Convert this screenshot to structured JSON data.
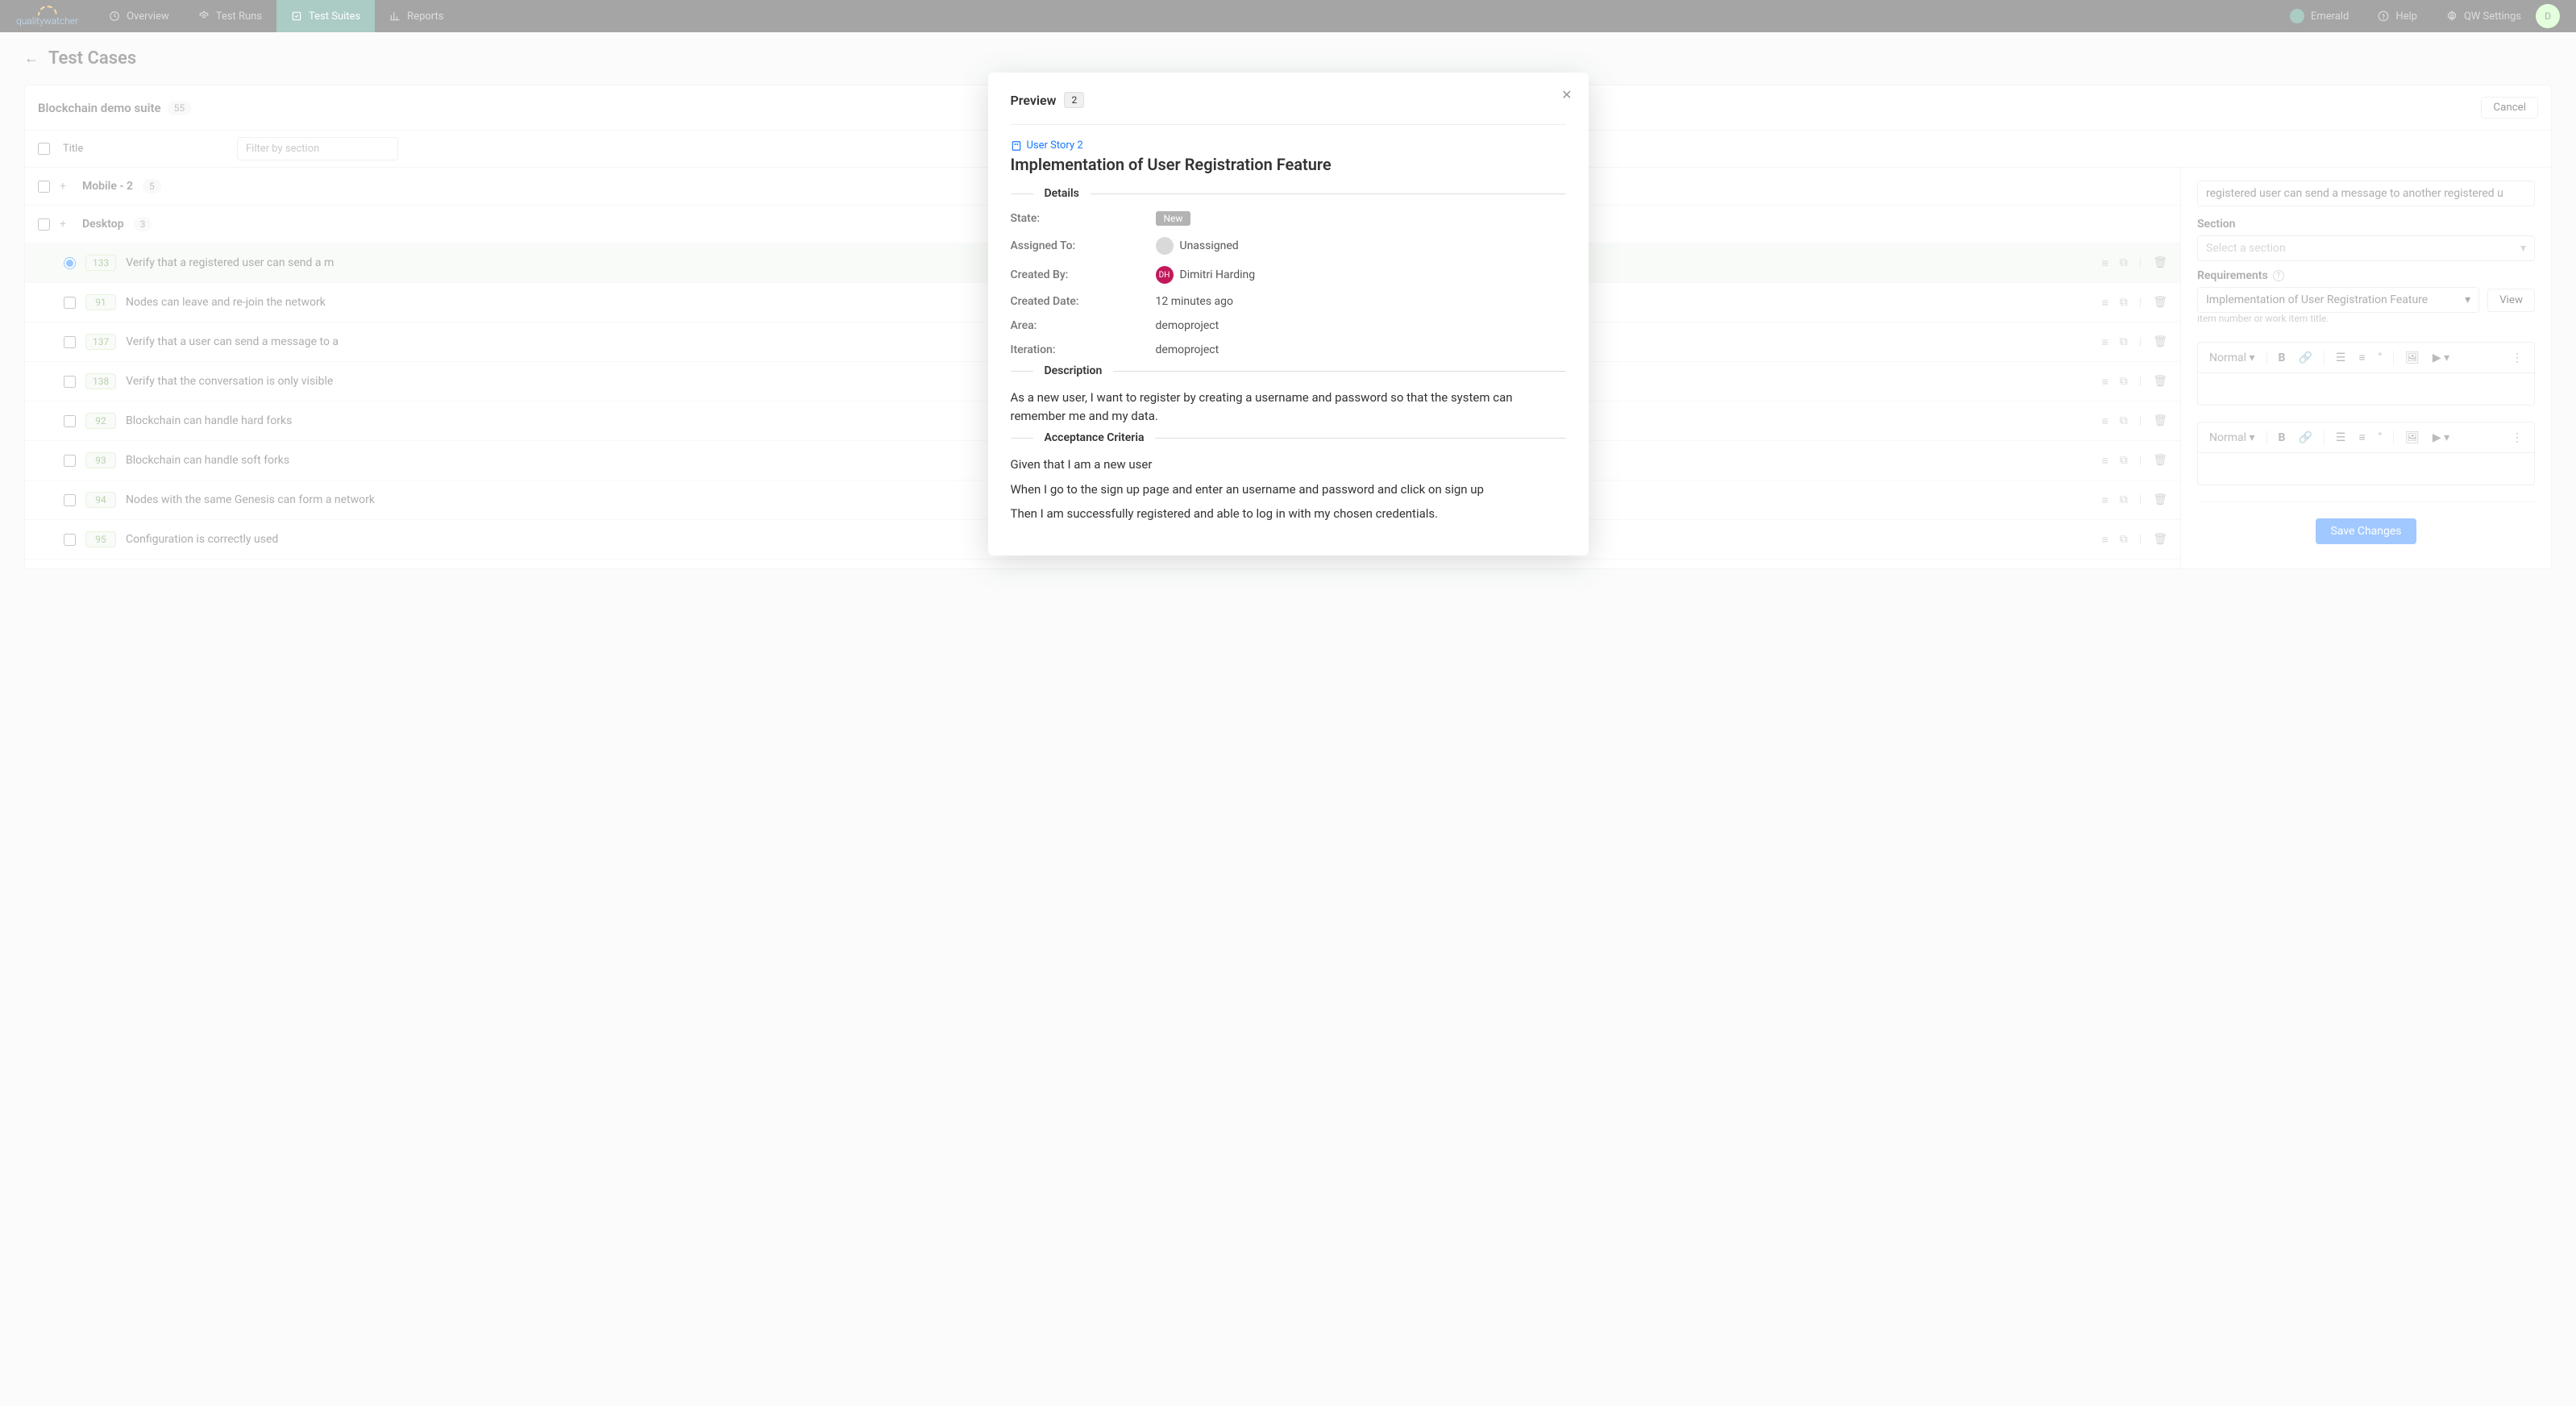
{
  "nav": {
    "logo": "qualitywatcher",
    "items": [
      "Overview",
      "Test Runs",
      "Test Suites",
      "Reports"
    ],
    "active_index": 2,
    "project": "Emerald",
    "help": "Help",
    "settings": "QW Settings",
    "avatar_initial": "D"
  },
  "page": {
    "title": "Test Cases",
    "suite_name": "Blockchain demo suite",
    "suite_count": "55",
    "cancel": "Cancel",
    "title_col": "Title",
    "filter_placeholder": "Filter by section"
  },
  "sections": [
    {
      "name": "Mobile - 2",
      "count": "5"
    },
    {
      "name": "Desktop",
      "count": "3"
    }
  ],
  "test_cases": [
    {
      "id": "133",
      "title": "Verify that a registered user can send a m",
      "selected": true
    },
    {
      "id": "91",
      "title": "Nodes can leave and re-join the network"
    },
    {
      "id": "137",
      "title": "Verify that a user can send a message to a"
    },
    {
      "id": "138",
      "title": "Verify that the conversation is only visible"
    },
    {
      "id": "92",
      "title": "Blockchain can handle hard forks"
    },
    {
      "id": "93",
      "title": "Blockchain can handle soft forks"
    },
    {
      "id": "94",
      "title": "Nodes with the same Genesis can form a network"
    },
    {
      "id": "95",
      "title": "Configuration is correctly used"
    }
  ],
  "side": {
    "title_value": "registered user can send a message to another registered u",
    "section_label": "Section",
    "section_placeholder": "Select a section",
    "requirements_label": "Requirements",
    "requirement_value": "Implementation of User Registration Feature",
    "req_hint": "item number or work item title.",
    "view": "View",
    "normal": "Normal",
    "save": "Save Changes"
  },
  "modal": {
    "header": "Preview",
    "badge": "2",
    "story_link": "User Story 2",
    "story_title": "Implementation of User Registration Feature",
    "details_label": "Details",
    "state_k": "State:",
    "state_v": "New",
    "assigned_k": "Assigned To:",
    "assigned_v": "Unassigned",
    "created_by_k": "Created By:",
    "created_by_v": "Dimitri Harding",
    "created_by_initials": "DH",
    "created_date_k": "Created Date:",
    "created_date_v": "12 minutes ago",
    "area_k": "Area:",
    "area_v": "demoproject",
    "iteration_k": "Iteration:",
    "iteration_v": "demoproject",
    "description_label": "Description",
    "description": "As a new user, I want to register by creating a username and password so that the system can remember me and my data.",
    "ac_label": "Acceptance Criteria",
    "ac_line1": "Given that I am a new user",
    "ac_line2": "When I go to the sign up page and enter an username and password and click on sign up",
    "ac_line3": "Then I am successfully registered and able to log in with my chosen credentials."
  }
}
